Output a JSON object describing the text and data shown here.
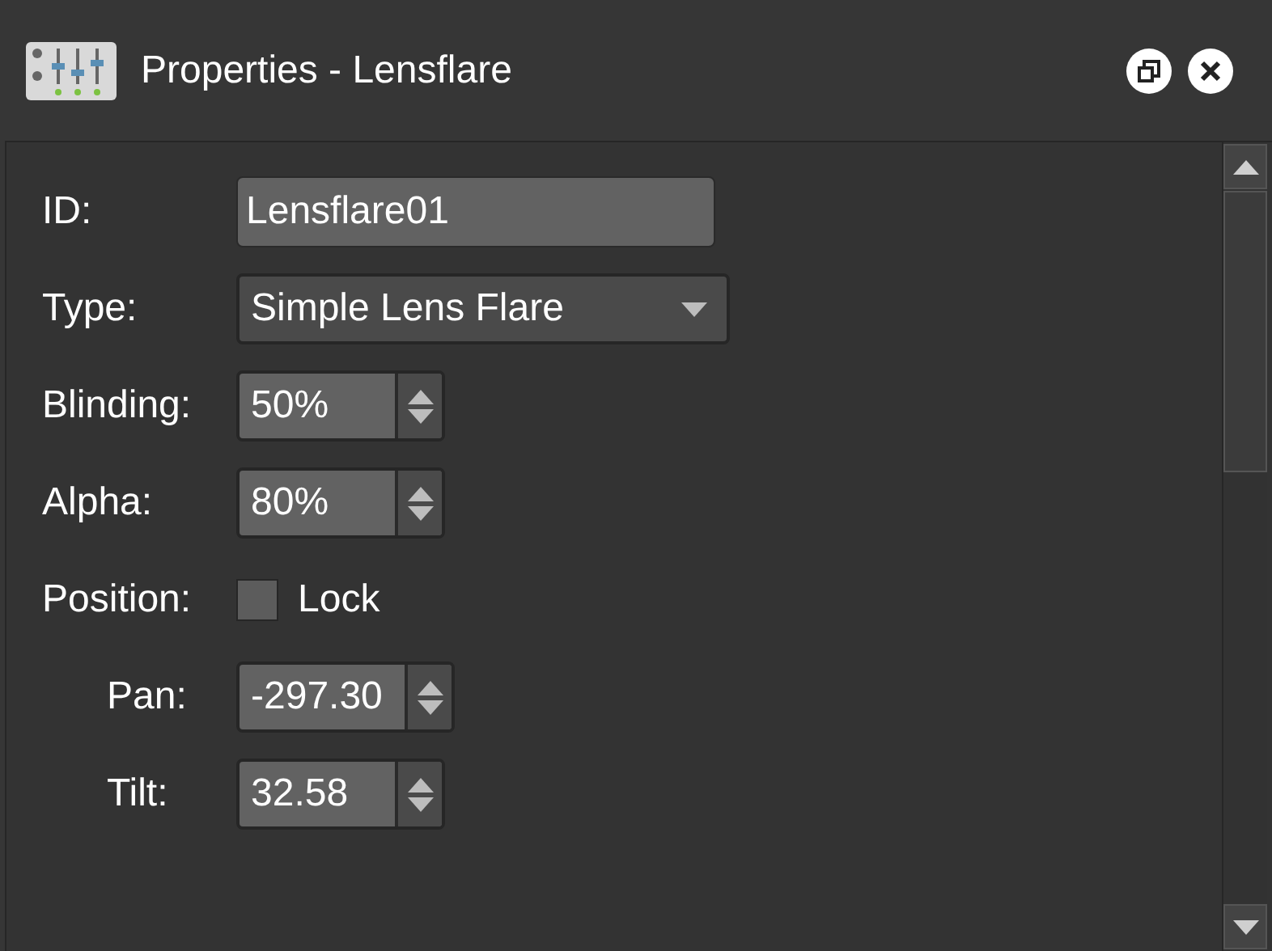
{
  "window": {
    "title": "Properties - Lensflare"
  },
  "fields": [
    {
      "kind": "text",
      "label": "ID:",
      "value": "Lensflare01"
    },
    {
      "kind": "dropdown",
      "label": "Type:",
      "value": "Simple Lens Flare"
    },
    {
      "kind": "spinner",
      "label": "Blinding:",
      "value": "50%"
    },
    {
      "kind": "spinner",
      "label": "Alpha:",
      "value": "80%"
    },
    {
      "kind": "checkbox",
      "label": "Position:",
      "option": "Lock",
      "checked": false,
      "children": [
        {
          "kind": "spinner",
          "label": "Pan:",
          "value": "-297.30"
        },
        {
          "kind": "spinner",
          "label": "Tilt:",
          "value": "32.58"
        }
      ]
    }
  ]
}
